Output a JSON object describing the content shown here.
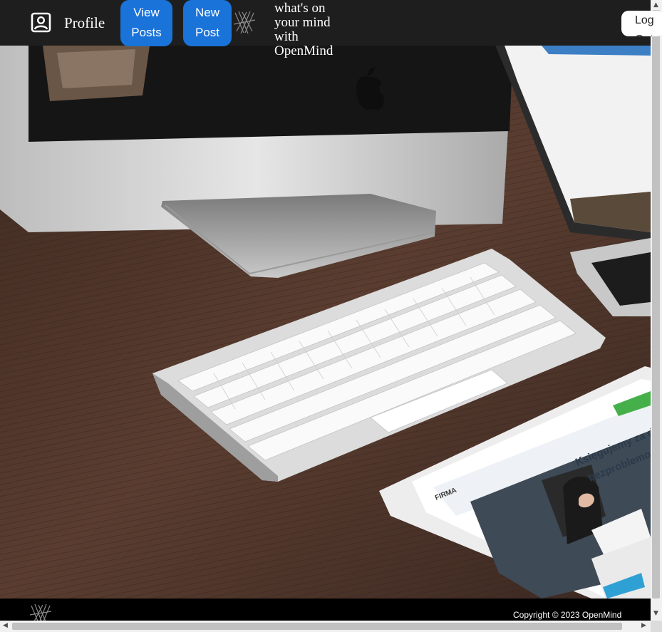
{
  "navbar": {
    "profile_label": "Profile",
    "view_posts_label": "View Posts",
    "new_post_label": "New Post",
    "tagline": "what's on your mind with OpenMind",
    "logout_label": "Log Out"
  },
  "footer": {
    "copyright": "Copyright © 2023 OpenMind"
  },
  "colors": {
    "navbar_bg": "#1e1e1e",
    "button_blue": "#1a73d9",
    "footer_bg": "#000000",
    "desk_wood": "#4a3328"
  },
  "icons": [
    "profile-icon",
    "openmind-logo-icon"
  ]
}
